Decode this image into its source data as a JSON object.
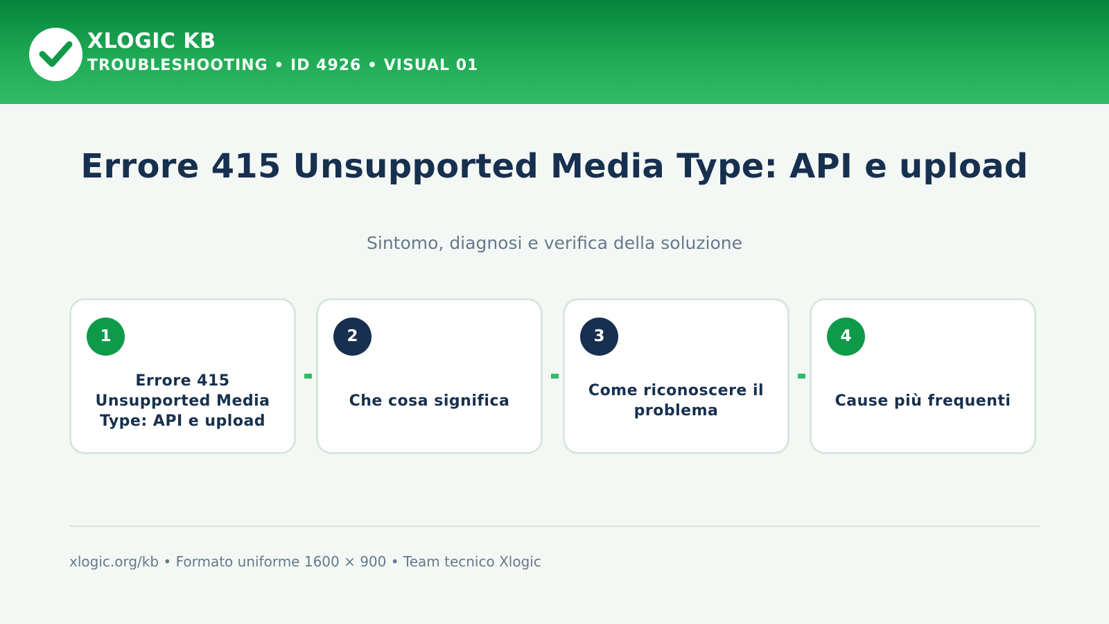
{
  "header": {
    "brand_name": "XLOGIC KB",
    "brand_subtitle": "TROUBLESHOOTING • ID 4926 • VISUAL 01",
    "logo_icon": "check-icon",
    "accent_color": "#0f9a4a"
  },
  "main": {
    "title": "Errore 415 Unsupported Media Type: API e upload",
    "subtitle": "Sintomo, diagnosi e verifica della soluzione",
    "steps": [
      {
        "number": "1",
        "label": "Errore 415 Unsupported Media Type: API e upload",
        "badge_color": "#0f9a4a"
      },
      {
        "number": "2",
        "label": "Che cosa significa",
        "badge_color": "#17304f"
      },
      {
        "number": "3",
        "label": "Come riconoscere il problema",
        "badge_color": "#17304f"
      },
      {
        "number": "4",
        "label": "Cause più frequenti",
        "badge_color": "#0f9a4a"
      }
    ]
  },
  "footer": {
    "text": "xlogic.org/kb • Formato uniforme 1600 × 900 • Team tecnico Xlogic"
  }
}
